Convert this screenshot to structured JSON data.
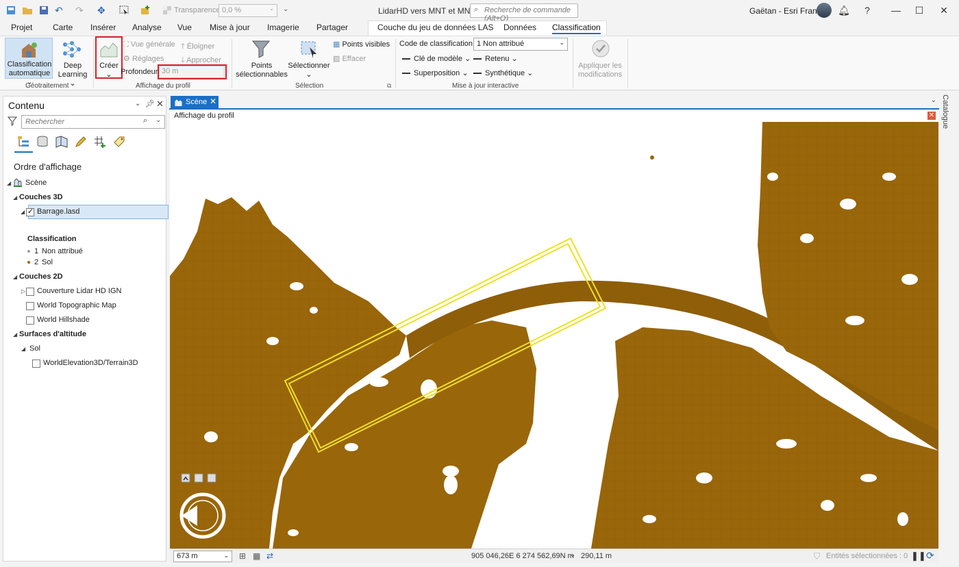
{
  "window": {
    "title": "LidarHD vers MNT et MNS",
    "command_search_placeholder": "Recherche de commande (Alt+Q)",
    "user": "Gaëtan - Esri France",
    "transparency_label": "Transparence",
    "transparency_value": "0,0 %"
  },
  "tabs": [
    {
      "label": "Projet"
    },
    {
      "label": "Carte"
    },
    {
      "label": "Insérer"
    },
    {
      "label": "Analyse"
    },
    {
      "label": "Vue"
    },
    {
      "label": "Mise à jour"
    },
    {
      "label": "Imagerie"
    },
    {
      "label": "Partager"
    },
    {
      "label": "Couche du jeu de données LAS"
    },
    {
      "label": "Données"
    },
    {
      "label": "Classification"
    }
  ],
  "ribbon": {
    "geotraitement": {
      "label": "Géotraitement",
      "auto_class_line1": "Classification",
      "auto_class_line2": "automatique",
      "deep_line1": "Deep",
      "deep_line2": "Learning"
    },
    "profile": {
      "label": "Affichage du profil",
      "create": "Créer",
      "overview": "Vue générale",
      "settings": "Réglages",
      "move_away": "Éloigner",
      "move_closer": "Approcher",
      "depth_label": "Profondeur",
      "depth_value": "30 m"
    },
    "selection": {
      "label": "Sélection",
      "selectable_line1": "Points",
      "selectable_line2": "sélectionnables",
      "select": "Sélectionner",
      "visible_points": "Points visibles",
      "clear": "Effacer"
    },
    "interactive": {
      "label": "Mise à jour interactive",
      "class_code_label": "Code de classification",
      "class_code_value": "1 Non attribué",
      "model_key": "Clé de modèle",
      "withheld": "Retenu",
      "overlap": "Superposition",
      "synthetic": "Synthétique"
    },
    "apply": {
      "line1": "Appliquer les",
      "line2": "modifications"
    }
  },
  "contents": {
    "title": "Contenu",
    "search_placeholder": "Rechercher",
    "display_order": "Ordre d'affichage",
    "scene": "Scène",
    "layers_3d": "Couches 3D",
    "las_layer": "Barrage.lasd",
    "classification_heading": "Classification",
    "classes": [
      {
        "code": "1",
        "name": "Non attribué",
        "color": "#a0a0a0"
      },
      {
        "code": "2",
        "name": "Sol",
        "color": "#a0620a"
      }
    ],
    "layers_2d": "Couches 2D",
    "layers_2d_items": [
      {
        "name": "Couverture Lidar HD IGN"
      },
      {
        "name": "World Topographic Map"
      },
      {
        "name": "World Hillshade"
      }
    ],
    "elevation_surfaces": "Surfaces d'altitude",
    "ground": "Sol",
    "terrain": "WorldElevation3D/Terrain3D"
  },
  "view": {
    "tab": "Scène",
    "profile_title": "Affichage du profil",
    "catalog": "Catalogue",
    "ground_color": "#99660a",
    "profile_box_color": "#f0e020"
  },
  "status": {
    "scale": "673 m",
    "coords": "905 046,26E 6 274 562,69N m",
    "elevation": "290,11 m",
    "selected": "Entités sélectionnées : 0"
  }
}
